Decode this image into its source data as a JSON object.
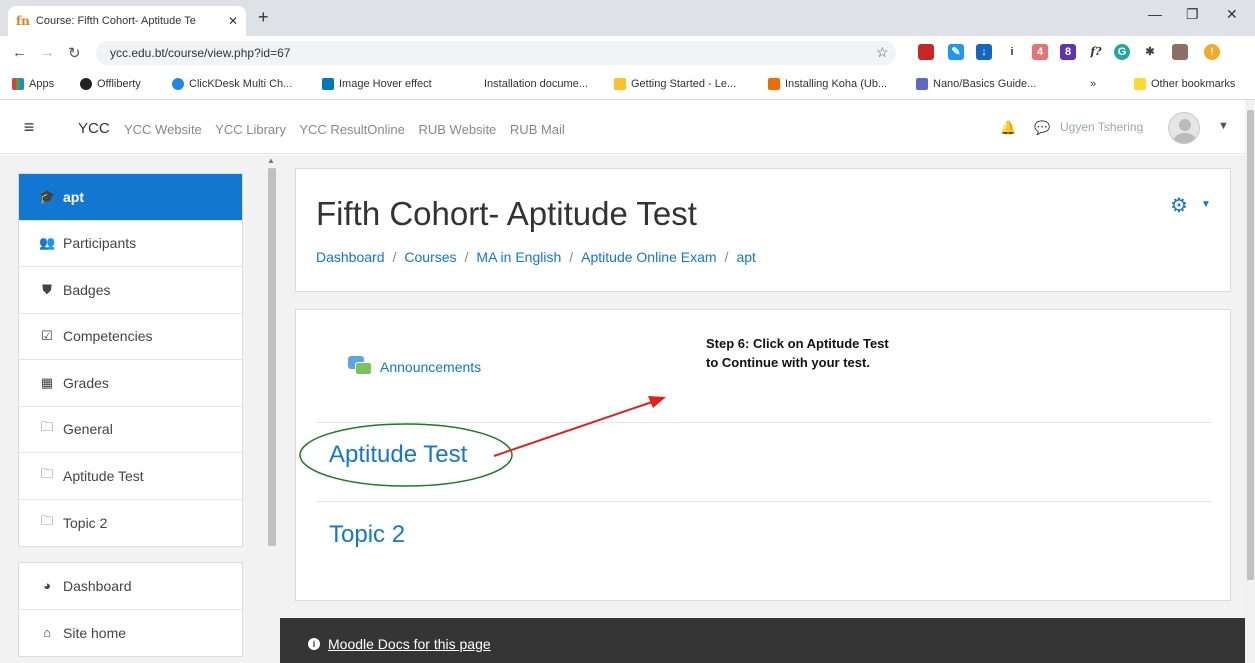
{
  "browser": {
    "tab_title": "Course: Fifth Cohort- Aptitude Te",
    "tab_icon": "fn",
    "url_dim": "← → C",
    "url": "ycc.edu.bt/course/view.php?id=67",
    "url_display": "ycc.edu.bt/course/view.php?id=67"
  },
  "bookmarks": [
    {
      "label": "Apps",
      "icon": "apps-grid"
    },
    {
      "label": "Offliberty",
      "icon": "power"
    },
    {
      "label": "ClicKDesk Multi Ch...",
      "icon": "chat-bubble"
    },
    {
      "label": "Image Hover effect",
      "icon": "blue-leaf"
    },
    {
      "label": "Installation docume...",
      "icon": "none"
    },
    {
      "label": "Getting Started - Le...",
      "icon": "flask"
    },
    {
      "label": "Installing Koha (Ub...",
      "icon": "koha"
    },
    {
      "label": "Nano/Basics Guide...",
      "icon": "nano"
    },
    {
      "label": "»",
      "icon": "none"
    },
    {
      "label": "Other bookmarks",
      "icon": "folder"
    }
  ],
  "moodle_nav": {
    "brand": "YCC",
    "links": [
      "YCC Website",
      "YCC Library",
      "YCC ResultOnline",
      "RUB Website",
      "RUB Mail"
    ],
    "user_name": "Ugyen Tshering"
  },
  "drawer": {
    "course_items": [
      {
        "label": "apt",
        "icon": "graduation-cap-icon",
        "glyph": "🎓",
        "active": true
      },
      {
        "label": "Participants",
        "icon": "users-icon",
        "glyph": "👥",
        "active": false
      },
      {
        "label": "Badges",
        "icon": "shield-icon",
        "glyph": "⛊",
        "active": false
      },
      {
        "label": "Competencies",
        "icon": "checkbox-icon",
        "glyph": "☑",
        "active": false
      },
      {
        "label": "Grades",
        "icon": "table-icon",
        "glyph": "▦",
        "active": false
      },
      {
        "label": "General",
        "icon": "folder-icon",
        "glyph": "🗀",
        "active": false
      },
      {
        "label": "Aptitude Test",
        "icon": "folder-icon",
        "glyph": "🗀",
        "active": false
      },
      {
        "label": "Topic 2",
        "icon": "folder-icon",
        "glyph": "🗀",
        "active": false
      }
    ],
    "site_items": [
      {
        "label": "Dashboard",
        "icon": "dashboard-icon",
        "glyph": "◕"
      },
      {
        "label": "Site home",
        "icon": "home-icon",
        "glyph": "⌂"
      }
    ]
  },
  "header": {
    "title": "Fifth Cohort- Aptitude Test",
    "breadcrumb": [
      "Dashboard",
      "Courses",
      "MA in English",
      "Aptitude Online Exam",
      "apt"
    ]
  },
  "content": {
    "announcements_label": "Announcements",
    "annotation_line1": "Step 6: Click on Aptitude Test",
    "annotation_line2": "to Continue with your test.",
    "sections": [
      "Aptitude Test",
      "Topic 2"
    ]
  },
  "footer": {
    "docs_link": "Moodle Docs for this page"
  },
  "colors": {
    "accent": "#1177d1",
    "annotation_circle": "#1e7b1e",
    "annotation_arrow": "#e3211c",
    "footer_bg": "#353535"
  }
}
